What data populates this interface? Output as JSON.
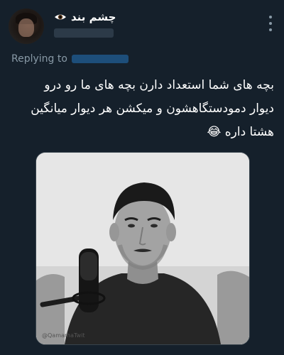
{
  "header": {
    "display_name": "چشم بند",
    "handle": ""
  },
  "reply": {
    "label": "Replying to",
    "handle": ""
  },
  "tweet": {
    "lines": [
      "بچه های شما استعداد دارن بچه های ما رو درو",
      "دیوار دمودستگاهشون و میکشن هر دیوار میانگین",
      "هشتا داره 😂"
    ]
  },
  "media": {
    "watermark": "@QamarhaTwit"
  },
  "colors": {
    "background": "#15202b",
    "muted_text": "#8899a6",
    "border": "#38444d"
  }
}
